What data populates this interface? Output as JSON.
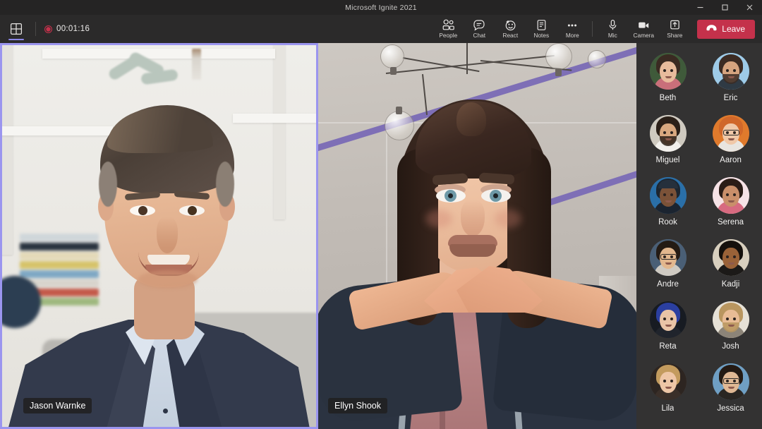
{
  "window": {
    "title": "Microsoft Ignite 2021",
    "controls": [
      {
        "name": "minimize-button",
        "glyph": "minimize"
      },
      {
        "name": "maximize-button",
        "glyph": "maximize"
      },
      {
        "name": "close-button",
        "glyph": "close"
      }
    ]
  },
  "actionbar": {
    "layout_button": {
      "name": "gallery-layout-icon",
      "label": ""
    },
    "recording": {
      "timer": "00:01:16",
      "indicator_color": "#c4314b"
    },
    "controls": [
      {
        "label": "People",
        "icon": "people-icon"
      },
      {
        "label": "Chat",
        "icon": "chat-icon"
      },
      {
        "label": "React",
        "icon": "react-icon"
      },
      {
        "label": "Notes",
        "icon": "notes-icon"
      },
      {
        "label": "More",
        "icon": "more-ellipsis-icon"
      }
    ],
    "device_controls": [
      {
        "label": "Mic",
        "icon": "microphone-icon"
      },
      {
        "label": "Camera",
        "icon": "camera-icon"
      },
      {
        "label": "Share",
        "icon": "share-screen-icon"
      }
    ],
    "leave": {
      "label": "Leave",
      "icon": "hangup-icon",
      "color": "#c4314b"
    }
  },
  "stage": {
    "tiles": [
      {
        "name": "Jason Warnke",
        "kind": "video",
        "active_speaker": true,
        "active_border_color": "#9b95ef"
      },
      {
        "name": "Ellyn Shook",
        "kind": "avatar",
        "active_speaker": false,
        "active_border_color": "#9b95ef"
      }
    ]
  },
  "roster": {
    "participants": [
      {
        "name": "Beth",
        "hair": "#3a2a22",
        "skin": "#e8bb9c",
        "bg": "#3f5a3a",
        "body": "#c96f7a",
        "accessory": "none"
      },
      {
        "name": "Eric",
        "hair": "#3b2b23",
        "skin": "#d6a47f",
        "bg": "#9ecbe8",
        "body": "#2f3a44",
        "accessory": "beard"
      },
      {
        "name": "Miguel",
        "hair": "#2b2018",
        "skin": "#d9a87f",
        "bg": "#cfcac0",
        "body": "#f2f0ec",
        "accessory": "beard"
      },
      {
        "name": "Aaron",
        "hair": "#d0672a",
        "skin": "#f0c8a8",
        "bg": "#e07a2c",
        "body": "#e8e5e0",
        "accessory": "glasses"
      },
      {
        "name": "Rook",
        "hair": "#1d2630",
        "skin": "#7b5238",
        "bg": "#2a6fa8",
        "body": "#1b2430",
        "accessory": "hat"
      },
      {
        "name": "Serena",
        "hair": "#2a1c16",
        "skin": "#c98f6a",
        "bg": "#f6e2e6",
        "body": "#d76a80",
        "accessory": "none"
      },
      {
        "name": "Andre",
        "hair": "#241b14",
        "skin": "#e2b78e",
        "bg": "#4a5f76",
        "body": "#cfcac2",
        "accessory": "glasses"
      },
      {
        "name": "Kadji",
        "hair": "#15100c",
        "skin": "#9a6238",
        "bg": "#d8cfbe",
        "body": "#1c1a18",
        "accessory": "none"
      },
      {
        "name": "Reta",
        "hair": "#2b3fa0",
        "skin": "#e9c4a6",
        "bg": "#171b22",
        "body": "#20242c",
        "accessory": "none"
      },
      {
        "name": "Josh",
        "hair": "#b9965f",
        "skin": "#e8bc95",
        "bg": "#e6e1d6",
        "body": "#8c8478",
        "accessory": "beard"
      },
      {
        "name": "Lila",
        "hair": "#c39b5e",
        "skin": "#eec6a6",
        "bg": "#2d2521",
        "body": "#3a2f29",
        "accessory": "none"
      },
      {
        "name": "Jessica",
        "hair": "#241a14",
        "skin": "#e0b894",
        "bg": "#6f9fc4",
        "body": "#2a2622",
        "accessory": "glasses"
      }
    ]
  }
}
